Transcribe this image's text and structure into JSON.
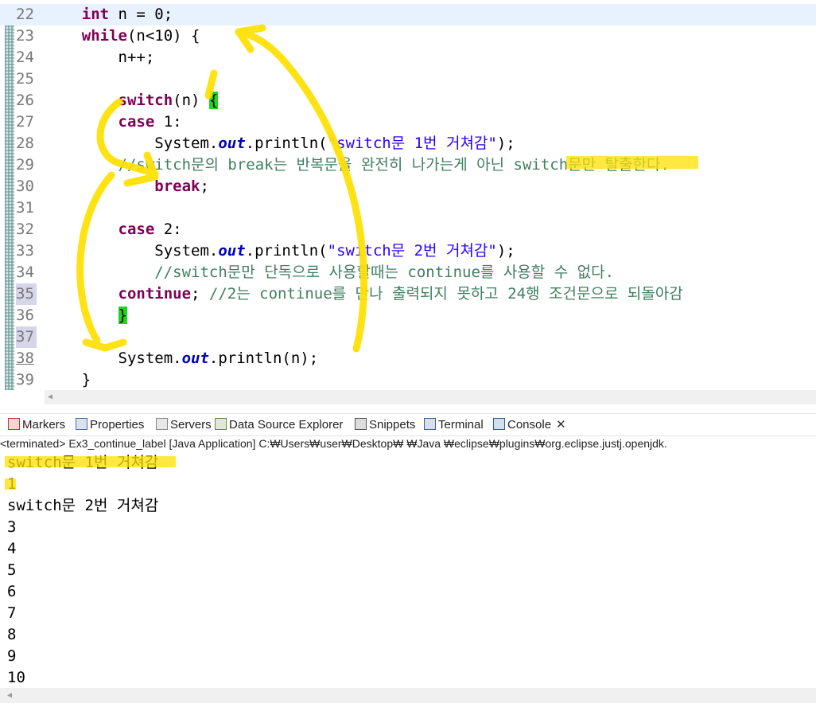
{
  "editor": {
    "lines": [
      {
        "n": "22",
        "current": true,
        "html": "    <span class='kw'>int</span> n = 0;"
      },
      {
        "n": "23",
        "html": "    <span class='kw'>while</span>(n&lt;10) {"
      },
      {
        "n": "24",
        "html": "        n++;"
      },
      {
        "n": "25",
        "html": ""
      },
      {
        "n": "26",
        "html": "        <span class='kw'>switch</span>(n) <span class='brk'>{</span>"
      },
      {
        "n": "27",
        "html": "        <span class='kw'>case</span> 1:"
      },
      {
        "n": "28",
        "html": "            System.<span class='fld'>out</span>.println(<span class='str'>\"switch문 1번 거쳐감\"</span>);"
      },
      {
        "n": "29",
        "html": "        <span class='cmt'>//switch문의 break는 반복문을 완전히 나가는게 아닌 switch문만 탈출한다.</span>"
      },
      {
        "n": "30",
        "html": "            <span class='kw'>break</span>;"
      },
      {
        "n": "31",
        "html": ""
      },
      {
        "n": "32",
        "html": "        <span class='kw'>case</span> 2:"
      },
      {
        "n": "33",
        "html": "            System.<span class='fld'>out</span>.println(<span class='str'>\"switch문 2번 거쳐감\"</span>);"
      },
      {
        "n": "34",
        "html": "            <span class='cmt'>//switch문만 단독으로 사용할때는 continue를 사용할 수 없다.</span>"
      },
      {
        "n": "35",
        "mark": true,
        "html": "        <span class='kw'>continue</span>; <span class='cmt'>//2는 continue를 만나 출력되지 못하고 24행 조건문으로 되돌아감</span>"
      },
      {
        "n": "36",
        "html": "        <span class='brk'>}</span>"
      },
      {
        "n": "37",
        "mark": true,
        "html": ""
      },
      {
        "n": "38",
        "ul": true,
        "html": "        System.<span class='fld'>out</span>.println(n);"
      },
      {
        "n": "39",
        "html": "    }"
      }
    ]
  },
  "tabs": [
    {
      "label": "Markers",
      "icon": "markers-icon",
      "color": "#c0392b"
    },
    {
      "label": "Properties",
      "icon": "properties-icon",
      "color": "#4a6ea8"
    },
    {
      "label": "Servers",
      "icon": "servers-icon",
      "color": "#888888"
    },
    {
      "label": "Data Source Explorer",
      "icon": "data-source-icon",
      "color": "#6a8a3a"
    },
    {
      "label": "Snippets",
      "icon": "snippets-icon",
      "color": "#555555"
    },
    {
      "label": "Terminal",
      "icon": "terminal-icon",
      "color": "#3a5f9a"
    },
    {
      "label": "Console",
      "icon": "console-icon",
      "color": "#2f5f8f",
      "active": true,
      "close": "✕"
    }
  ],
  "status": {
    "text": "<terminated> Ex3_continue_label [Java Application] C:₩Users₩user₩Desktop₩        ₩Java                                        ₩eclipse₩plugins₩org.eclipse.justj.openjdk."
  },
  "console": {
    "lines": [
      "switch문 1번 거쳐감",
      "1",
      "switch문 2번 거쳐감",
      "3",
      "4",
      "5",
      "6",
      "7",
      "8",
      "9",
      "10"
    ]
  },
  "colors": {
    "highlight": "#ffe000",
    "accent": "#1fd61f"
  }
}
